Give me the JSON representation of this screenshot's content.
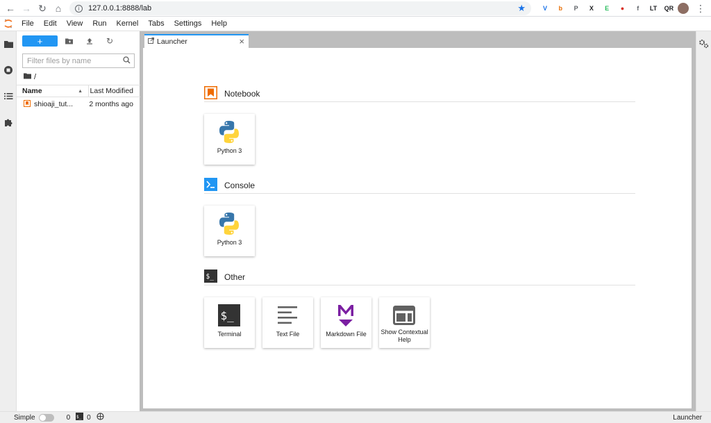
{
  "browser": {
    "url": "127.0.0.1:8888/lab",
    "extensions": [
      {
        "name": "ext-v-icon",
        "label": "V",
        "color": "#1a73e8"
      },
      {
        "name": "ext-b-icon",
        "label": "b",
        "color": "#e8710a"
      },
      {
        "name": "ext-pocket-icon",
        "label": "P",
        "color": "#5f6368"
      },
      {
        "name": "ext-x-icon",
        "label": "X",
        "color": "#202124"
      },
      {
        "name": "ext-evernote-icon",
        "label": "E",
        "color": "#2dbe60"
      },
      {
        "name": "ext-red-icon",
        "label": "●",
        "color": "#d93025"
      },
      {
        "name": "ext-flag-icon",
        "label": "f",
        "color": "#5f6368"
      },
      {
        "name": "ext-lt-icon",
        "label": "LT",
        "color": "#202124"
      },
      {
        "name": "ext-qr-icon",
        "label": "QR",
        "color": "#202124"
      },
      {
        "name": "ext-puzzle-icon",
        "label": "✚",
        "color": "#5f6368"
      }
    ]
  },
  "menubar": {
    "items": [
      "File",
      "Edit",
      "View",
      "Run",
      "Kernel",
      "Tabs",
      "Settings",
      "Help"
    ]
  },
  "filebrowser": {
    "new_label": "+",
    "filter_placeholder": "Filter files by name",
    "breadcrumb": "/",
    "col_name": "Name",
    "col_modified": "Last Modified",
    "files": [
      {
        "name": "shioaji_tut...",
        "modified": "2 months ago"
      }
    ]
  },
  "tab": {
    "label": "Launcher"
  },
  "launcher": {
    "sections": [
      {
        "title": "Notebook",
        "cards": [
          {
            "label": "Python 3"
          }
        ]
      },
      {
        "title": "Console",
        "cards": [
          {
            "label": "Python 3"
          }
        ]
      },
      {
        "title": "Other",
        "cards": [
          {
            "label": "Terminal"
          },
          {
            "label": "Text File"
          },
          {
            "label": "Markdown File"
          },
          {
            "label": "Show Contextual Help"
          }
        ]
      }
    ]
  },
  "statusbar": {
    "mode_label": "Simple",
    "terminals_count": "0",
    "kernels_count": "0",
    "current": "Launcher"
  },
  "colors": {
    "accent": "#2196f3",
    "notebook_icon": "#ef6c00",
    "markdown_icon": "#7b1fa2"
  }
}
